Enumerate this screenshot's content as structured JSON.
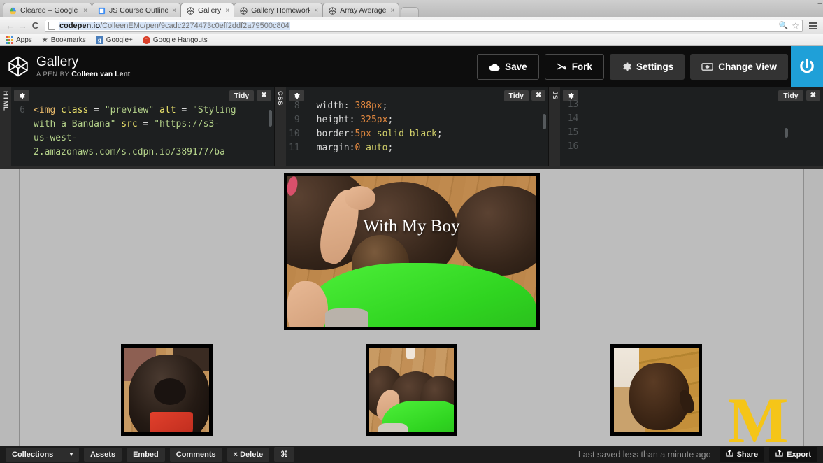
{
  "browser": {
    "tabs": [
      {
        "title": "Cleared – Google Drive",
        "icon": "google-drive-icon",
        "active": false
      },
      {
        "title": "JS Course Outline – Goog",
        "icon": "google-docs-icon",
        "active": false
      },
      {
        "title": "Gallery",
        "icon": "codepen-icon",
        "active": true
      },
      {
        "title": "Gallery Homework",
        "icon": "codepen-icon",
        "active": false
      },
      {
        "title": "Array Average",
        "icon": "codepen-icon",
        "active": false
      }
    ],
    "close_label": "×",
    "nav": {
      "back_icon": "back-arrow-icon",
      "forward_icon": "forward-arrow-icon",
      "reload_icon": "reload-icon",
      "back_glyph": "←",
      "forward_glyph": "→",
      "reload_glyph": "C"
    },
    "url": {
      "domain": "codepen.io",
      "path": "/ColleenEMc/pen/9cadc2274473c0eff2ddf2a79500c804",
      "full": "codepen.io/ColleenEMc/pen/9cadc2274473c0eff2ddf2a79500c804"
    },
    "bookmarks": [
      {
        "label": "Apps",
        "icon": "apps-grid-icon"
      },
      {
        "label": "Bookmarks",
        "icon": "star-icon"
      },
      {
        "label": "Google+",
        "icon": "google-plus-icon",
        "badge": "g"
      },
      {
        "label": "Google Hangouts",
        "icon": "hangouts-icon",
        "badge": "”"
      }
    ]
  },
  "pen": {
    "title": "Gallery",
    "byline_prefix": "A PEN BY",
    "author": "Colleen van Lent",
    "logo_icon": "codepen-logo-icon",
    "actions": [
      {
        "label": "Save",
        "icon": "cloud-icon",
        "style": "outline"
      },
      {
        "label": "Fork",
        "icon": "fork-icon",
        "style": "outline"
      },
      {
        "label": "Settings",
        "icon": "gear-icon",
        "style": "solid"
      },
      {
        "label": "Change View",
        "icon": "screen-icon",
        "style": "solid"
      }
    ],
    "power_icon": "power-icon",
    "accent_blue": "#1fa0d8"
  },
  "editors": [
    {
      "lang": "HTML",
      "tidy_label": "Tidy",
      "close_label": "✖",
      "gear_icon": "gear-icon",
      "gutter": [
        "6",
        "",
        "",
        ""
      ],
      "code_lines": [
        "<img class = \"preview\" alt = \"Styling",
        "with a Bandana\" src = \"https://s3-",
        "us-west-",
        "2.amazonaws.com/s.cdpn.io/389177/ba"
      ]
    },
    {
      "lang": "CSS",
      "tidy_label": "Tidy",
      "close_label": "✖",
      "gear_icon": "gear-icon",
      "gutter": [
        "8",
        "9",
        "10",
        "11"
      ],
      "code_lines": [
        "width: 388px;",
        "height: 325px;",
        "border:5px solid black;",
        "margin:0 auto;"
      ]
    },
    {
      "lang": "JS",
      "tidy_label": "Tidy",
      "close_label": "✖",
      "gear_icon": "gear-icon",
      "gutter": [
        "13",
        "14",
        "15",
        "16"
      ],
      "code_lines": [
        "",
        "",
        "",
        ""
      ]
    }
  ],
  "preview": {
    "hero_caption": "With My Boy",
    "hero_alt": "boy hugging two dark curly dogs on a wood floor",
    "thumbnails": [
      {
        "alt": "black curly dog wearing a red bandana"
      },
      {
        "alt": "boy in a bright green shirt hugging dogs"
      },
      {
        "alt": "brown curly puppy sitting on wooden stairs"
      }
    ],
    "watermark": {
      "letter": "M",
      "name": "university-of-michigan-logo",
      "color": "#f5c518"
    }
  },
  "footer": {
    "collections_label": "Collections",
    "caret": "▾",
    "buttons": [
      "Assets",
      "Embed",
      "Comments"
    ],
    "delete_label": "× Delete",
    "command_glyph": "⌘",
    "saved_text": "Last saved less than a minute ago",
    "share_label": "Share",
    "export_label": "Export",
    "share_icon": "share-icon",
    "export_icon": "export-icon"
  }
}
